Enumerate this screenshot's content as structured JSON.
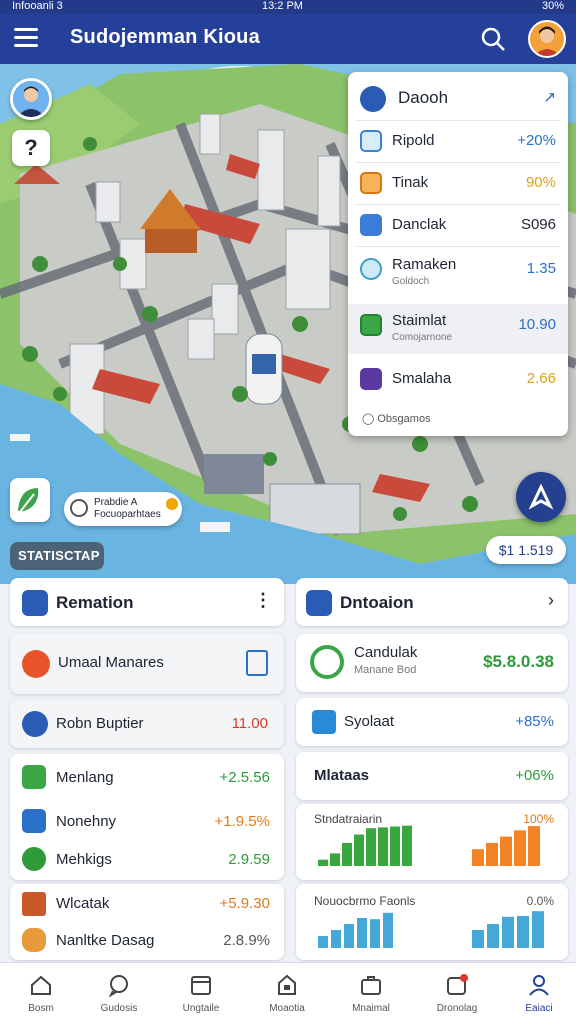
{
  "status_bar": {
    "left": "Infooanli 3",
    "time": "13:2 PM",
    "right": "30%"
  },
  "header": {
    "title": "Sudojemman Kioua"
  },
  "map": {
    "help_symbol": "?",
    "promo": {
      "line1": "Prabdie A",
      "line2": "Focuoparhtaes"
    },
    "price_chip": "$1 1.519",
    "stats_chip": "STATISCTAP"
  },
  "panel": {
    "title": "Daooh",
    "items": [
      {
        "label": "Ripold",
        "value": "+20%",
        "color": "#2a70c9"
      },
      {
        "label": "Tinak",
        "value": "90%",
        "color": "#e0a01a"
      },
      {
        "label": "Danclak",
        "value": "S096",
        "color": "#1d2433"
      },
      {
        "label": "Ramaken",
        "sub": "Goldoch",
        "value": "1.35",
        "color": "#2a70c9"
      },
      {
        "label": "Staimlat",
        "sub": "Comojarnone",
        "value": "10.90",
        "color": "#2a70c9"
      },
      {
        "label": "Smalaha",
        "value": "2.66",
        "color": "#e0a01a"
      }
    ],
    "footer": "Obsgamos"
  },
  "left_column": {
    "header": "Remation",
    "notice": "Umaal Manares",
    "supplier": {
      "label": "Robn Buptier",
      "value": "11.00"
    },
    "list1": [
      {
        "label": "Menlang",
        "value": "+2.5.56"
      },
      {
        "label": "Nonehny",
        "value": "+1.9.5%"
      },
      {
        "label": "Mehkigs",
        "value": "2.9.59"
      }
    ],
    "list2": [
      {
        "label": "Wlcatak",
        "value": "+5.9.30"
      },
      {
        "label": "Nanltke Dasag",
        "value": "2.8.9%"
      }
    ]
  },
  "right_column": {
    "header": "Dntoaion",
    "highlight": {
      "label": "Candulak",
      "sub": "Manane Bod",
      "value": "$5.8.0.38"
    },
    "stat1": {
      "label": "Syolaat",
      "value": "+85%"
    },
    "stat2": {
      "label": "Mlataas",
      "value": "+06%"
    },
    "chart1": {
      "title": "Stndatraiarin",
      "pct": "100%"
    },
    "chart2": {
      "title": "Nouocbrmo Faonls",
      "pct": "0.0%"
    }
  },
  "chart_data": [
    {
      "type": "bar",
      "title": "Stndatraiarin",
      "values": [
        0.15,
        0.3,
        0.55,
        0.75,
        0.9,
        0.92,
        0.94,
        0.96
      ],
      "series_colors": [
        "#3aa640"
      ]
    },
    {
      "type": "bar",
      "title": "Stndatraiarin",
      "values": [
        0.4,
        0.55,
        0.7,
        0.85,
        0.95
      ],
      "series_colors": [
        "#f28427"
      ]
    },
    {
      "type": "bar",
      "title": "Nouocbrmo Faonls",
      "values": [
        0.3,
        0.45,
        0.6,
        0.75,
        0.72,
        0.88
      ],
      "series_colors": [
        "#46a8d8"
      ]
    },
    {
      "type": "bar",
      "title": "Nouocbrmo Faonls",
      "values": [
        0.45,
        0.6,
        0.78,
        0.8,
        0.92
      ],
      "series_colors": [
        "#46a8d8"
      ]
    }
  ],
  "tabs": [
    {
      "label": "Bosm"
    },
    {
      "label": "Gudosis"
    },
    {
      "label": "Ungtaile"
    },
    {
      "label": "Moaotia"
    },
    {
      "label": "Mnaimal"
    },
    {
      "label": "Dronolag"
    },
    {
      "label": "Eaiaci"
    }
  ],
  "colors": {
    "brand": "#25409a",
    "positive": "#2e9a3a",
    "warning": "#e07b1a",
    "negative": "#d93a2b"
  }
}
